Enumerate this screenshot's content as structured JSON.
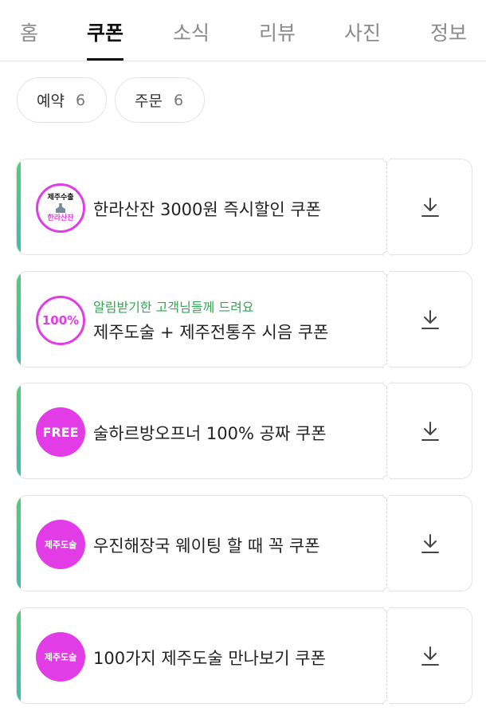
{
  "tabs": [
    {
      "label": "홈",
      "active": false
    },
    {
      "label": "쿠폰",
      "active": true
    },
    {
      "label": "소식",
      "active": false
    },
    {
      "label": "리뷰",
      "active": false
    },
    {
      "label": "사진",
      "active": false
    },
    {
      "label": "정보",
      "active": false
    }
  ],
  "filters": [
    {
      "label": "예약",
      "count": "6"
    },
    {
      "label": "주문",
      "count": "6"
    }
  ],
  "coupons": [
    {
      "logo_line1": "제주수출",
      "logo_line2": "한라산잔",
      "subtitle": "",
      "title": "한라산잔 3000원 즉시할인 쿠폰",
      "action_icon": "download-icon"
    },
    {
      "logo_text": "100%",
      "subtitle": "알림받기한 고객님들께 드려요",
      "title": "제주도술 + 제주전통주 시음 쿠폰",
      "action_icon": "download-icon"
    },
    {
      "logo_text": "FREE",
      "subtitle": "",
      "title": "술하르방오프너 100% 공짜 쿠폰",
      "action_icon": "download-icon"
    },
    {
      "logo_text": "제주도술",
      "subtitle": "",
      "title": "우진해장국 웨이팅 할 때 꼭 쿠폰",
      "action_icon": "download-icon"
    },
    {
      "logo_text": "제주도술",
      "subtitle": "",
      "title": "100가지 제주도술 만나보기 쿠폰",
      "action_icon": "download-icon"
    }
  ],
  "colors": {
    "accent_green": "#4fcf7a",
    "brand_magenta": "#e23ce6",
    "subtitle_green": "#2fa94f"
  }
}
